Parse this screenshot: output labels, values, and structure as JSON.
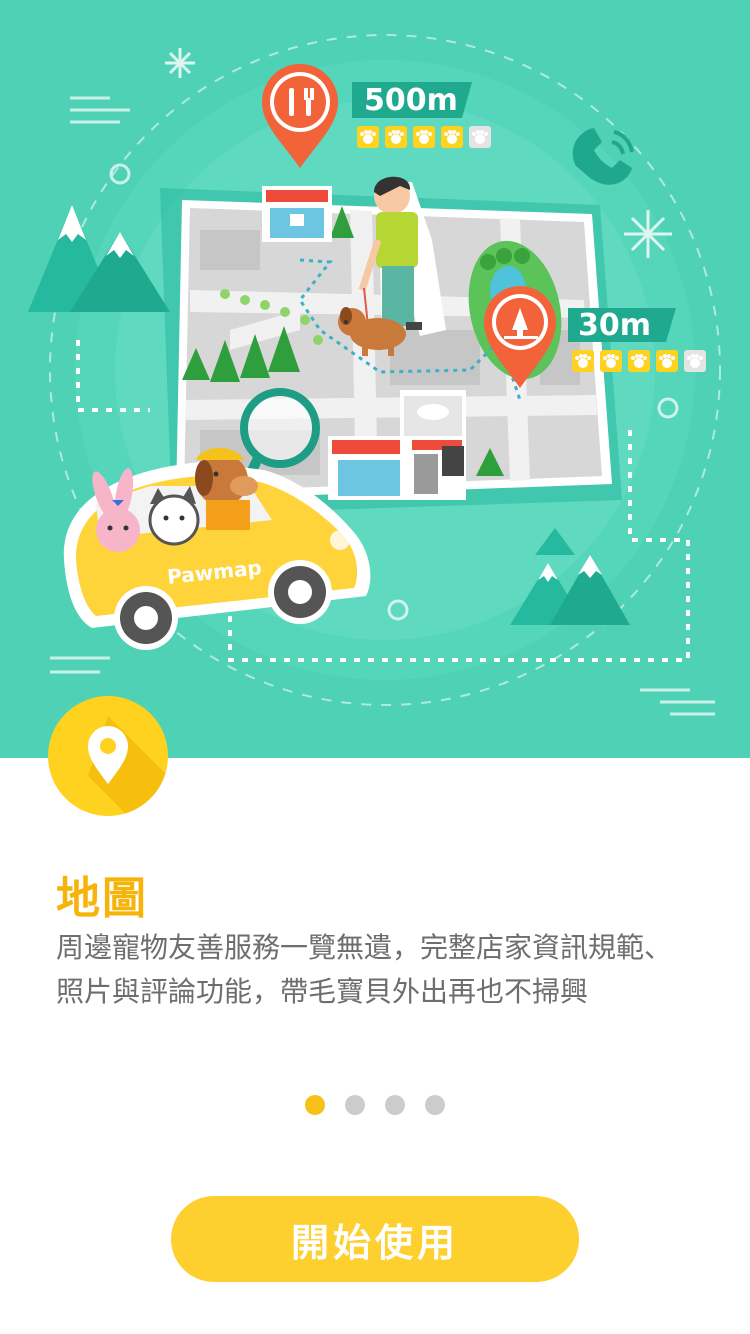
{
  "hero": {
    "distance_far": "500m",
    "distance_near": "30m",
    "rating_far": 4,
    "rating_near": 4,
    "rating_max": 5,
    "car_brand": "Pawmap"
  },
  "feature": {
    "icon": "map-pin-icon",
    "title": "地圖",
    "desc_line1": "周邊寵物友善服務一覽無遺，完整店家資訊規範、",
    "desc_line2": "照片與評論功能，帶毛寶貝外出再也不掃興"
  },
  "pager": {
    "count": 4,
    "active": 0
  },
  "start_button": {
    "label": "開始使用"
  },
  "colors": {
    "hero_bg": "#4fd1b5",
    "accent_yellow": "#fdcf2f",
    "title_color": "#f6b40a",
    "pin_orange": "#f2633a"
  }
}
